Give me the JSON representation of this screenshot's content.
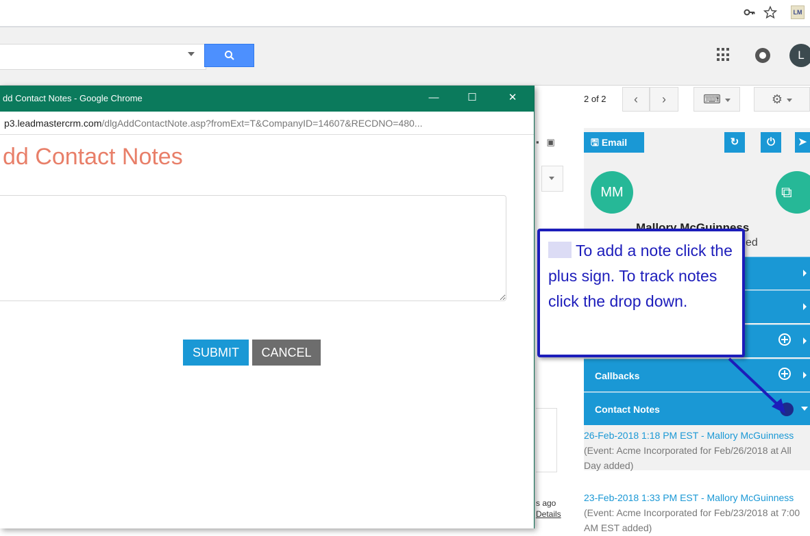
{
  "browser": {
    "toolbar_icons": [
      "key-icon",
      "star-icon"
    ],
    "extension_label": "LM"
  },
  "gmail": {
    "search": {
      "value": "",
      "placeholder": ""
    },
    "avatar_initial": "L",
    "pager": "2 of 2",
    "toolbar_glyphs": {
      "prev": "‹",
      "next": "›",
      "keyboard": "⌨",
      "settings": "⚙"
    },
    "background_snippet": {
      "ago": "s ago",
      "details": "Details"
    }
  },
  "popup": {
    "window_title": "dd Contact Notes - Google Chrome",
    "url_domain": "p3.leadmastercrm.com",
    "url_path": "/dlgAddContactNote.asp?fromExt=T&CompanyID=14607&RECDNO=480...",
    "heading": "dd Contact Notes",
    "notes_value": "",
    "submit_label": "SUBMIT",
    "cancel_label": "CANCEL",
    "controls": {
      "minimize": "—",
      "maximize": "☐",
      "close": "✕"
    }
  },
  "crm": {
    "email_label": "Email",
    "initials": "MM",
    "contact_name": "Mallory McGuinness",
    "subtitle": "ed",
    "rows": [
      {
        "label": ""
      },
      {
        "label": ""
      },
      {
        "label": ""
      },
      {
        "label": "Callbacks"
      },
      {
        "label": "Contact Notes"
      }
    ],
    "notes": [
      {
        "link": "26-Feb-2018 1:18 PM EST - Mallory McGuinness",
        "text": "(Event: Acme Incorporated for Feb/26/2018 at All Day added)"
      },
      {
        "link": "23-Feb-2018 1:33 PM EST - Mallory McGuinness",
        "text": "(Event: Acme Incorporated for Feb/23/2018 at 7:00 AM EST added)"
      }
    ]
  },
  "callout": {
    "text": "To add a note click the plus sign. To track notes click the drop down."
  },
  "colors": {
    "crm_blue": "#1a98d5",
    "popup_title_green": "#0b7a5c",
    "heading_salmon": "#e87f69",
    "callout_blue": "#1c1dba",
    "avatar_teal": "#26b897"
  }
}
